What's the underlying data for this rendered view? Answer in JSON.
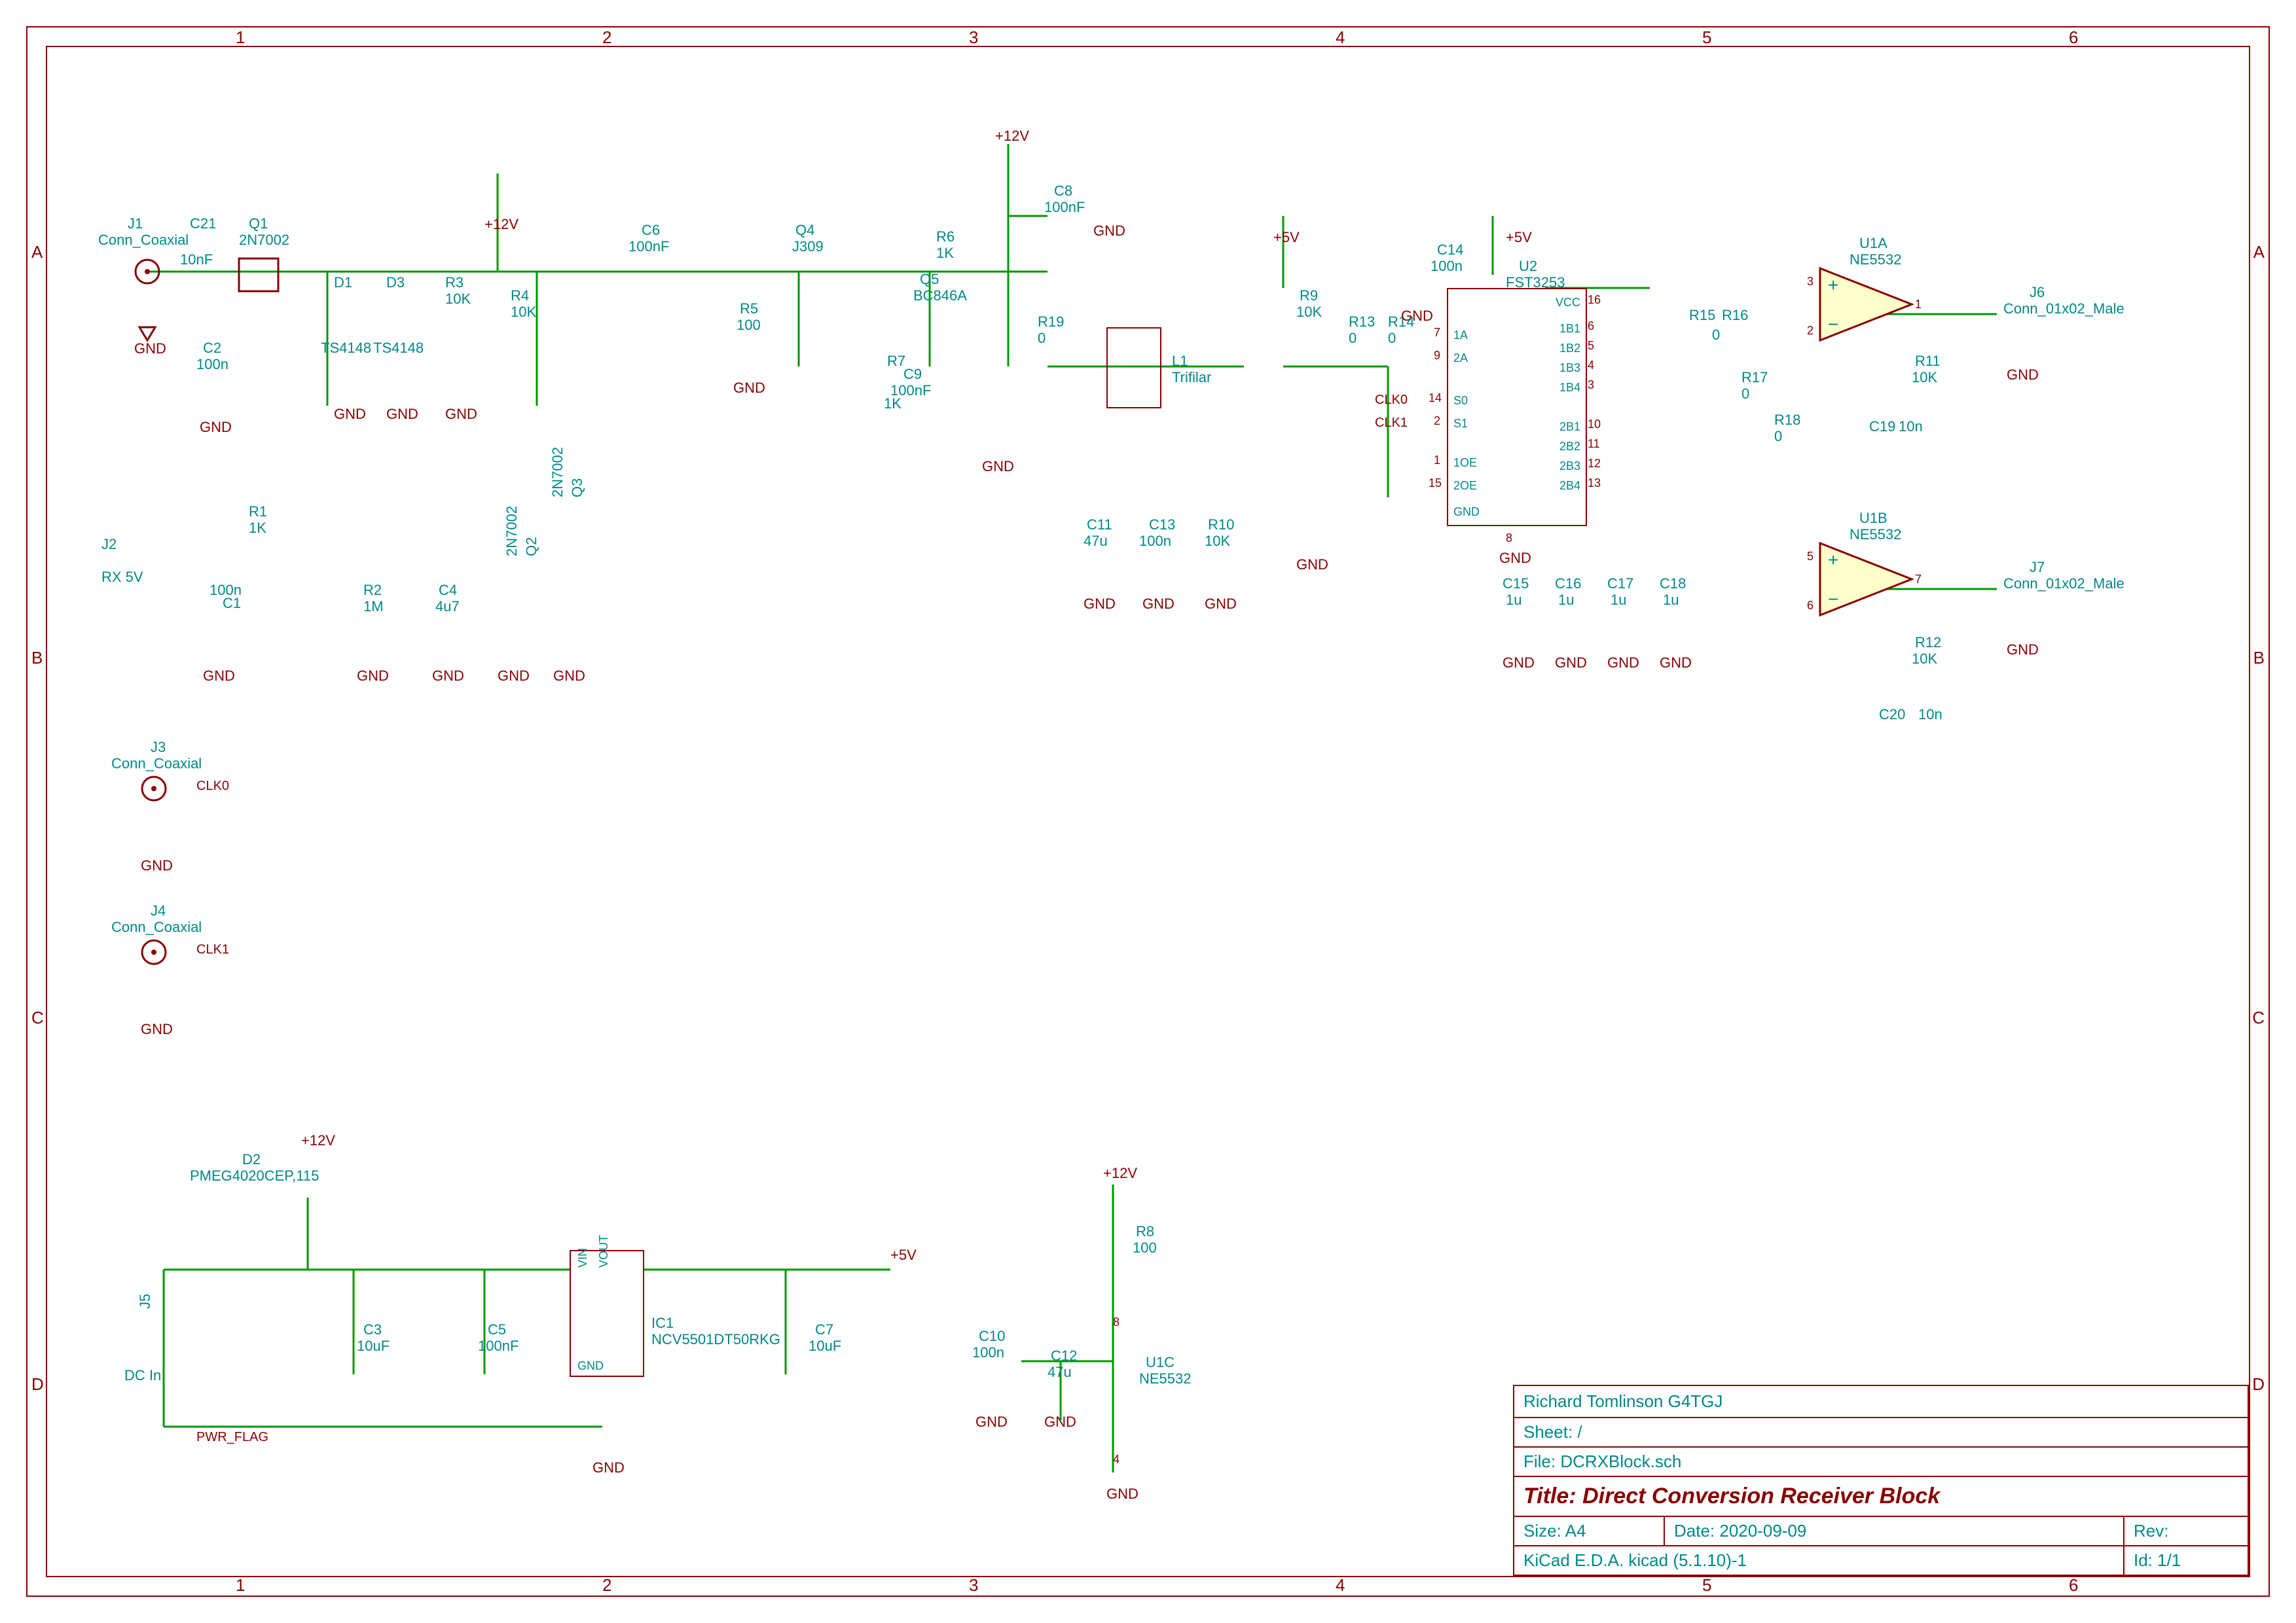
{
  "title_block": {
    "author": "Richard Tomlinson G4TGJ",
    "sheet_label": "Sheet:",
    "sheet_path": "/",
    "file_label": "File:",
    "file_name": "DCRXBlock.sch",
    "title_label": "Title:",
    "title": "Direct Conversion Receiver Block",
    "size_label": "Size:",
    "size": "A4",
    "date_label": "Date:",
    "date": "2020-09-09",
    "rev_label": "Rev:",
    "rev": "",
    "tool": "KiCad E.D.A.  kicad (5.1.10)-1",
    "id_label": "Id:",
    "id": "1/1"
  },
  "ruler": {
    "cols": [
      "1",
      "2",
      "3",
      "4",
      "5",
      "6"
    ],
    "rows": [
      "A",
      "B",
      "C",
      "D"
    ]
  },
  "nets": {
    "p12v": "+12V",
    "p5v": "+5V",
    "gnd": "GND",
    "clk0": "CLK0",
    "clk1": "CLK1",
    "rx5v": "RX 5V",
    "pwr_flag": "PWR_FLAG",
    "dcin": "DC In"
  },
  "components": {
    "J1": {
      "ref": "J1",
      "value": "Conn_Coaxial"
    },
    "C21": {
      "ref": "C21",
      "value": "10nF"
    },
    "Q1": {
      "ref": "Q1",
      "value": "2N7002"
    },
    "D1": {
      "ref": "D1",
      "value": "TS4148"
    },
    "D3": {
      "ref": "D3",
      "value": "TS4148"
    },
    "R3": {
      "ref": "R3",
      "value": "10K"
    },
    "R4": {
      "ref": "R4",
      "value": "10K"
    },
    "C2": {
      "ref": "C2",
      "value": "100n"
    },
    "R1": {
      "ref": "R1",
      "value": "1K"
    },
    "J2": {
      "ref": "J2",
      "label": "RX 5V"
    },
    "C1": {
      "ref": "C1",
      "value": "100n"
    },
    "R2": {
      "ref": "R2",
      "value": "1M"
    },
    "C4": {
      "ref": "C4",
      "value": "4u7"
    },
    "Q2": {
      "ref": "Q2",
      "value": "2N7002"
    },
    "Q3": {
      "ref": "Q3",
      "value": "2N7002"
    },
    "C6": {
      "ref": "C6",
      "value": "100nF"
    },
    "R5": {
      "ref": "R5",
      "value": "100"
    },
    "Q4": {
      "ref": "Q4",
      "value": "J309"
    },
    "C8": {
      "ref": "C8",
      "value": "100nF"
    },
    "R6": {
      "ref": "R6",
      "value": "1K"
    },
    "Q5": {
      "ref": "Q5",
      "value": "BC846A"
    },
    "C9": {
      "ref": "C9",
      "value": "100nF"
    },
    "R7": {
      "ref": "R7",
      "value": "1K"
    },
    "R19": {
      "ref": "R19",
      "value": "0"
    },
    "L1": {
      "ref": "L1",
      "value": "Trifilar"
    },
    "C11": {
      "ref": "C11",
      "value": "47u"
    },
    "C13": {
      "ref": "C13",
      "value": "100n"
    },
    "R10": {
      "ref": "R10",
      "value": "10K"
    },
    "R9": {
      "ref": "R9",
      "value": "10K"
    },
    "R13": {
      "ref": "R13",
      "value": "0"
    },
    "R14": {
      "ref": "R14",
      "value": "0"
    },
    "C14": {
      "ref": "C14",
      "value": "100n"
    },
    "U2": {
      "ref": "U2",
      "value": "FST3253",
      "pins_left": [
        [
          "7",
          "1A"
        ],
        [
          "9",
          "2A"
        ],
        [
          "14",
          "S0"
        ],
        [
          "2",
          "S1"
        ],
        [
          "1",
          "1OE"
        ],
        [
          "15",
          "2OE"
        ],
        [
          "8",
          "GND"
        ]
      ],
      "pins_right": [
        [
          "16",
          "VCC"
        ],
        [
          "6",
          "1B1"
        ],
        [
          "5",
          "1B2"
        ],
        [
          "4",
          "1B3"
        ],
        [
          "3",
          "1B4"
        ],
        [
          "10",
          "2B1"
        ],
        [
          "11",
          "2B2"
        ],
        [
          "12",
          "2B3"
        ],
        [
          "13",
          "2B4"
        ]
      ]
    },
    "C15": {
      "ref": "C15",
      "value": "1u"
    },
    "C16": {
      "ref": "C16",
      "value": "1u"
    },
    "C17": {
      "ref": "C17",
      "value": "1u"
    },
    "C18": {
      "ref": "C18",
      "value": "1u"
    },
    "R15": {
      "ref": "R15",
      "value": "0"
    },
    "R16": {
      "ref": "R16",
      "value": "0"
    },
    "R17": {
      "ref": "R17",
      "value": "0"
    },
    "R18": {
      "ref": "R18",
      "value": "0"
    },
    "U1A": {
      "ref": "U1A",
      "value": "NE5532"
    },
    "U1B": {
      "ref": "U1B",
      "value": "NE5532"
    },
    "U1C": {
      "ref": "U1C",
      "value": "NE5532"
    },
    "R11": {
      "ref": "R11",
      "value": "10K"
    },
    "R12": {
      "ref": "R12",
      "value": "10K"
    },
    "C19": {
      "ref": "C19",
      "value": "10n"
    },
    "C20": {
      "ref": "C20",
      "value": "10n"
    },
    "J6": {
      "ref": "J6",
      "value": "Conn_01x02_Male"
    },
    "J7": {
      "ref": "J7",
      "value": "Conn_01x02_Male"
    },
    "J3": {
      "ref": "J3",
      "value": "Conn_Coaxial"
    },
    "J4": {
      "ref": "J4",
      "value": "Conn_Coaxial"
    },
    "J5": {
      "ref": "J5",
      "value": "DC In"
    },
    "D2": {
      "ref": "D2",
      "value": "PMEG4020CEP,115"
    },
    "C3": {
      "ref": "C3",
      "value": "10uF"
    },
    "C5": {
      "ref": "C5",
      "value": "100nF"
    },
    "IC1": {
      "ref": "IC1",
      "value": "NCV5501DT50RKG",
      "pin_vin": "VIN",
      "pin_vout": "VOUT",
      "pin_gnd": "GND"
    },
    "C7": {
      "ref": "C7",
      "value": "10uF"
    },
    "R8": {
      "ref": "R8",
      "value": "100"
    },
    "C10": {
      "ref": "C10",
      "value": "100n"
    },
    "C12": {
      "ref": "C12",
      "value": "47u"
    }
  }
}
